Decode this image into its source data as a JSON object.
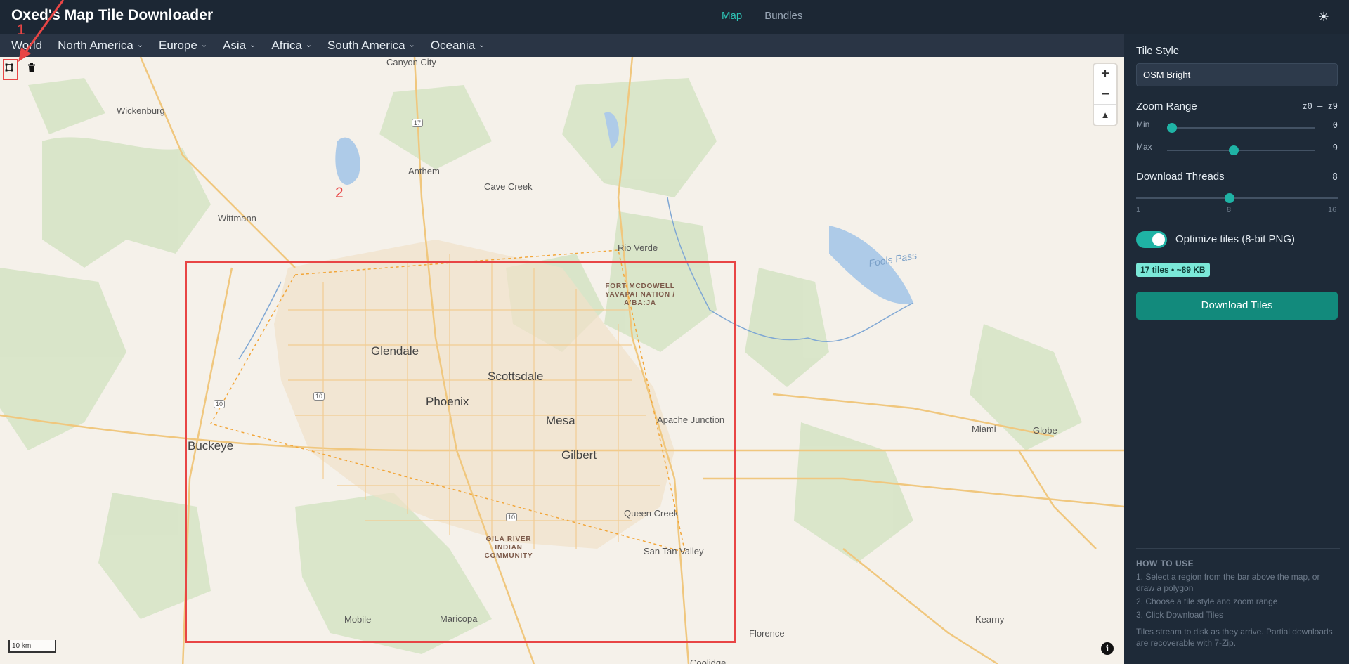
{
  "app": {
    "title": "Oxed's Map Tile Downloader",
    "theme_icon": "sun-icon"
  },
  "nav": {
    "tabs": [
      {
        "label": "Map",
        "active": true
      },
      {
        "label": "Bundles",
        "active": false
      }
    ]
  },
  "regions": [
    "World",
    "North America",
    "Europe",
    "Asia",
    "Africa",
    "South America",
    "Oceania"
  ],
  "map": {
    "tools": {
      "draw_icon": "polygon-draw-icon",
      "delete_icon": "trash-icon"
    },
    "zoom_in": "+",
    "zoom_out": "−",
    "compass": "▲",
    "scale": "10 km",
    "info": "i",
    "labels": {
      "canyon_city": "Canyon City",
      "wickenburg": "Wickenburg",
      "anthem": "Anthem",
      "cave_creek": "Cave Creek",
      "wittmann": "Wittmann",
      "rio_verde": "Rio Verde",
      "fort_mcdowell": "FORT MCDOWELL YAVAPAI NATION / A'BA:JA",
      "glendale": "Glendale",
      "scottsdale": "Scottsdale",
      "phoenix": "Phoenix",
      "mesa": "Mesa",
      "apache_junction": "Apache Junction",
      "buckeye": "Buckeye",
      "gilbert": "Gilbert",
      "queen_creek": "Queen Creek",
      "gila_river": "GILA RIVER INDIAN COMMUNITY",
      "san_tan_valley": "San Tan Valley",
      "mobile": "Mobile",
      "maricopa": "Maricopa",
      "florence": "Florence",
      "coolidge": "Coolidge",
      "miami": "Miami",
      "globe": "Globe",
      "kearny": "Kearny",
      "fools_pass": "Fools Pass",
      "shield_17": "17",
      "shield_10a": "10",
      "shield_10b": "10",
      "shield_10c": "10"
    },
    "annotations": {
      "one": "1",
      "two": "2"
    }
  },
  "sidebar": {
    "tile_style": {
      "label": "Tile Style",
      "value": "OSM Bright"
    },
    "zoom": {
      "label": "Zoom Range",
      "value": "z0 – z9",
      "min_label": "Min",
      "min": 0,
      "max_label": "Max",
      "max": 9,
      "min_display": "0",
      "max_display": "9"
    },
    "threads": {
      "label": "Download Threads",
      "value": 8,
      "value_display": "8",
      "tick_min": "1",
      "tick_mid": "8",
      "tick_max": "16"
    },
    "optimize": {
      "label": "Optimize tiles (8-bit PNG)",
      "enabled": true
    },
    "estimate": "17 tiles • ~89 KB",
    "download_button": "Download Tiles",
    "howto": {
      "title": "HOW TO USE",
      "steps": [
        "1. Select a region from the bar above the map, or draw a polygon",
        "2. Choose a tile style and zoom range",
        "3. Click Download Tiles"
      ],
      "note": "Tiles stream to disk as they arrive. Partial downloads are recoverable with 7-Zip."
    }
  },
  "colors": {
    "accent": "#1fb3a5",
    "header": "#1c2734",
    "sidebar": "#1e2a38",
    "selection": "#e84545"
  }
}
